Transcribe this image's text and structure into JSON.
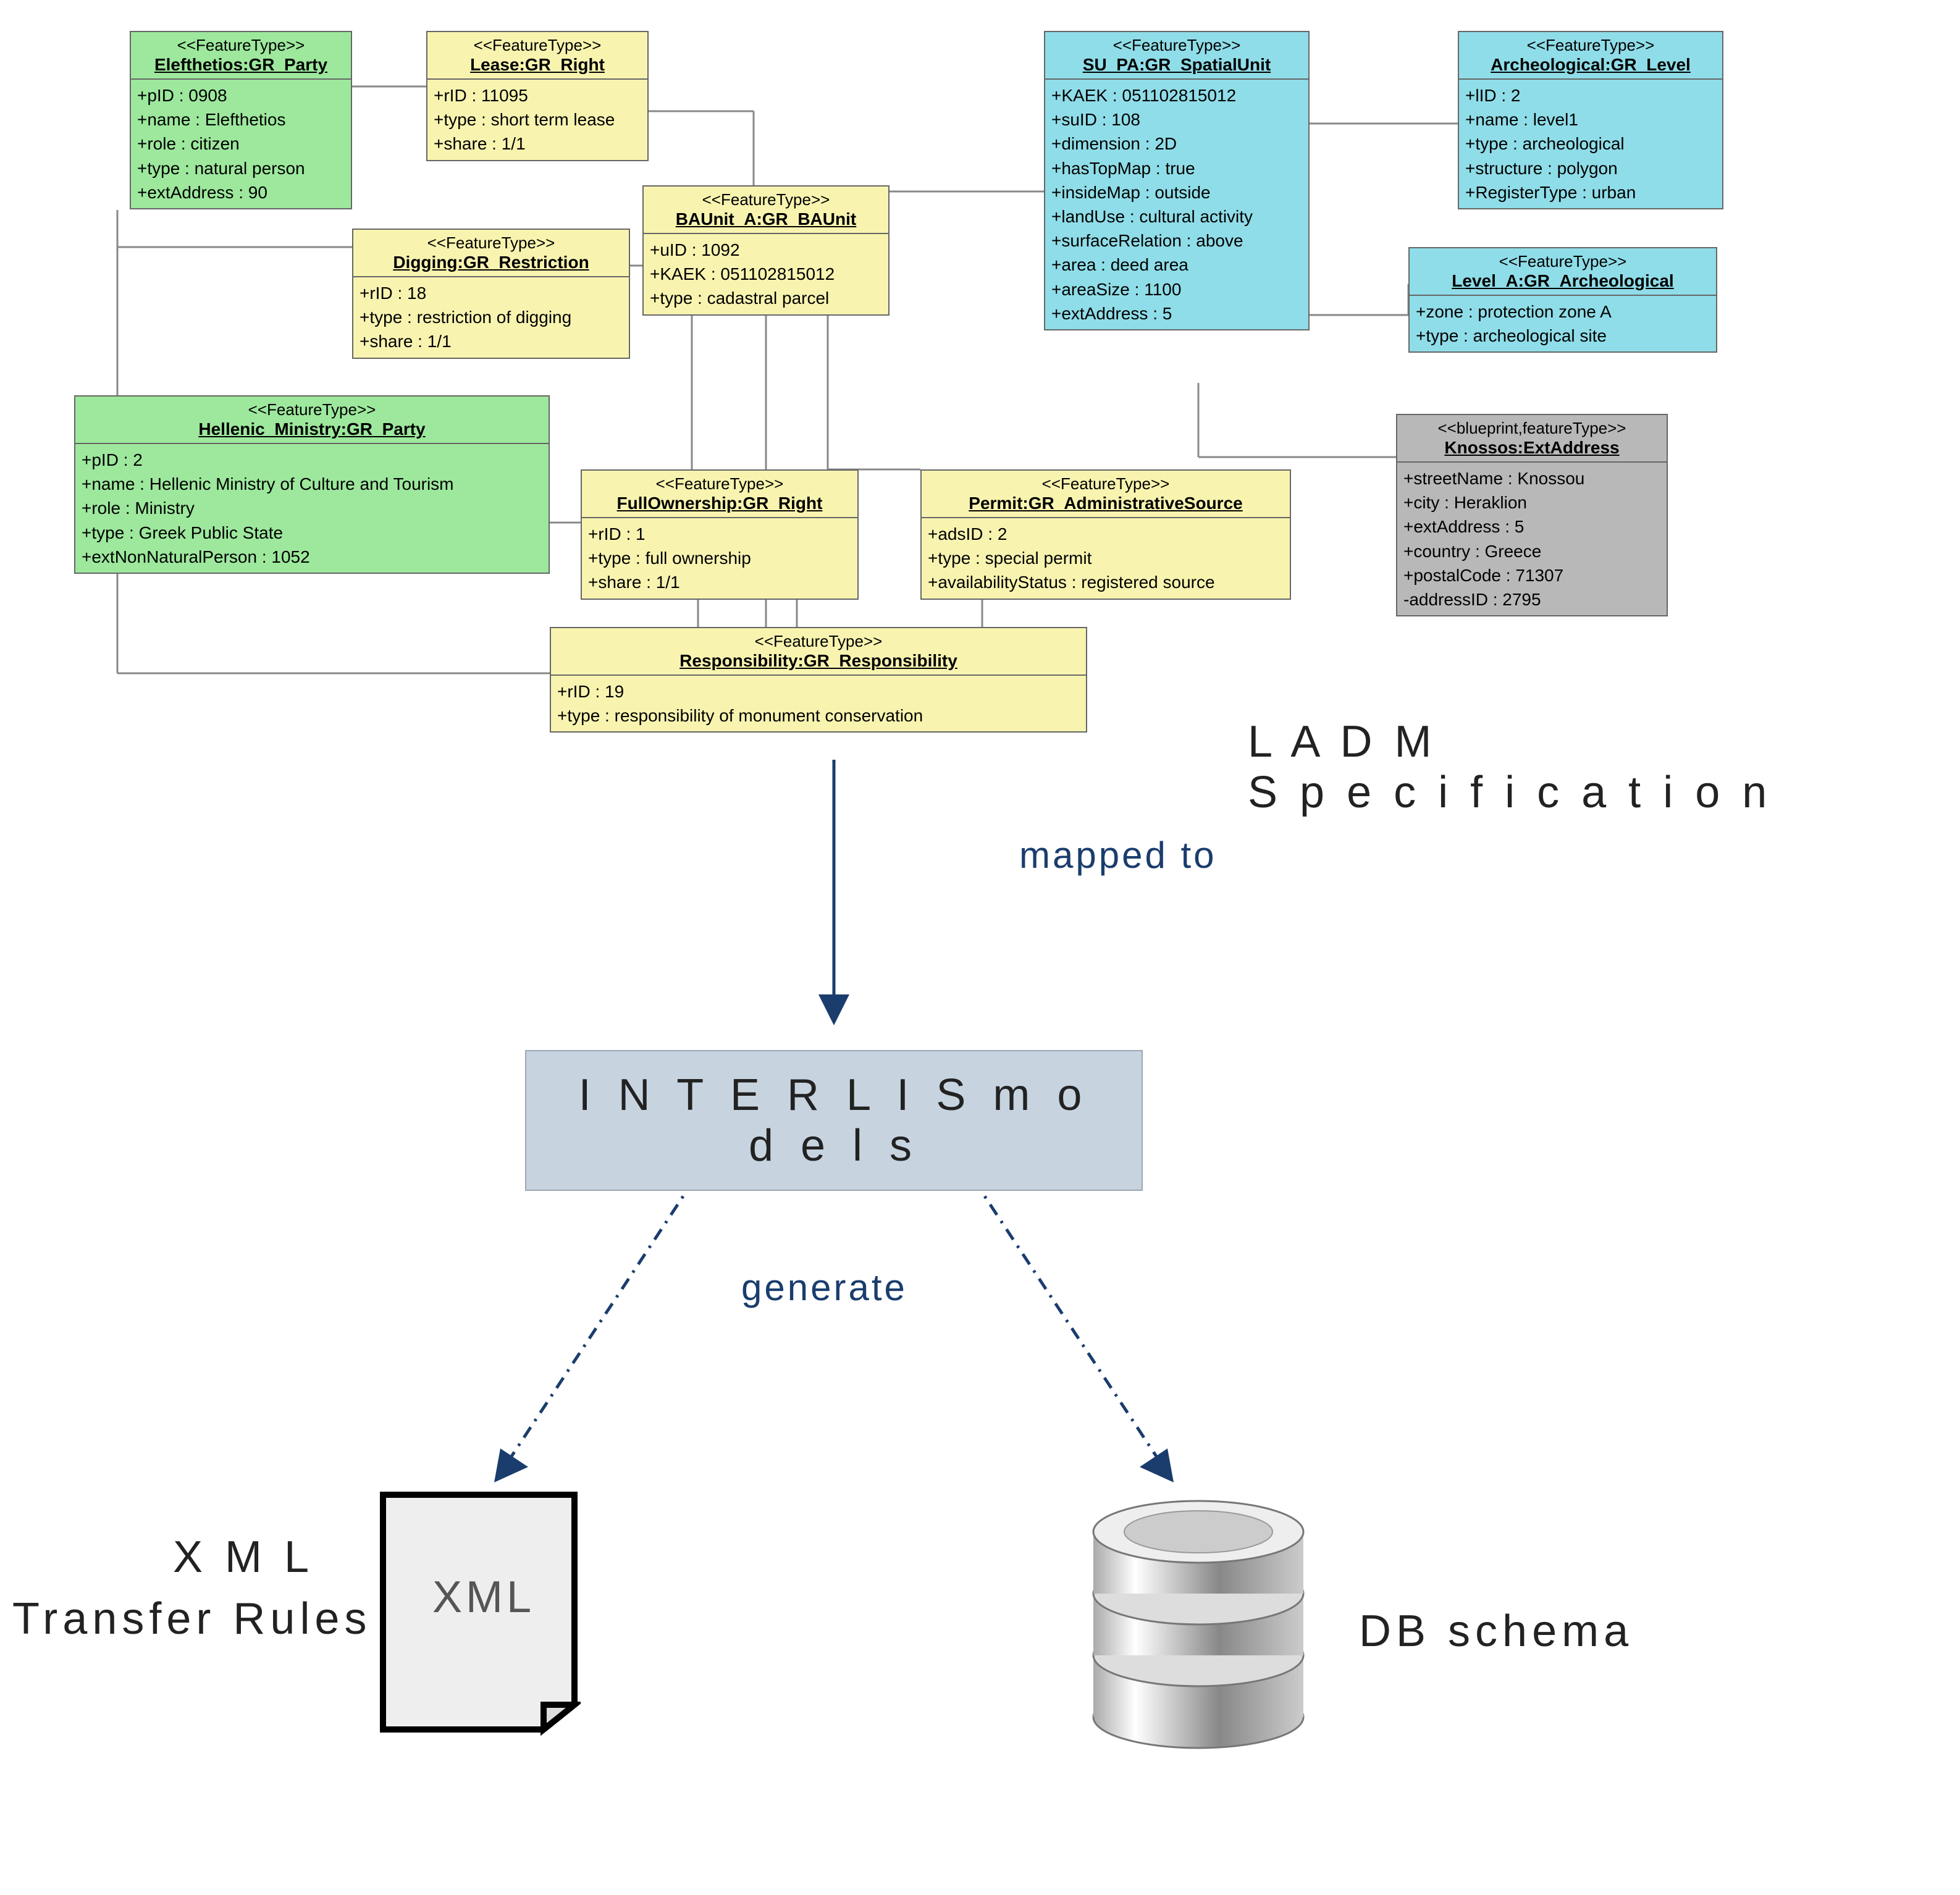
{
  "boxes": {
    "elefthetios": {
      "stereo": "<<FeatureType>>",
      "title": "Elefthetios:GR_Party",
      "attrs": [
        "+pID : 0908",
        "+name : Elefthetios",
        "+role : citizen",
        "+type : natural person",
        "+extAddress : 90"
      ]
    },
    "lease": {
      "stereo": "<<FeatureType>>",
      "title": "Lease:GR_Right",
      "attrs": [
        "+rID : 11095",
        "+type : short term lease",
        "+share : 1/1"
      ]
    },
    "baunit": {
      "stereo": "<<FeatureType>>",
      "title": "BAUnit_A:GR_BAUnit",
      "attrs": [
        "+uID : 1092",
        "+KAEK : 051102815012",
        "+type : cadastral parcel"
      ]
    },
    "digging": {
      "stereo": "<<FeatureType>>",
      "title": "Digging:GR_Restriction",
      "attrs": [
        "+rID : 18",
        "+type : restriction of digging",
        "+share : 1/1"
      ]
    },
    "hellenic": {
      "stereo": "<<FeatureType>>",
      "title": "Hellenic_Ministry:GR_Party",
      "attrs": [
        "+pID : 2",
        "+name : Hellenic Ministry of Culture and Tourism",
        "+role : Ministry",
        "+type : Greek Public State",
        "+extNonNaturalPerson : 1052"
      ]
    },
    "fullown": {
      "stereo": "<<FeatureType>>",
      "title": "FullOwnership:GR_Right",
      "attrs": [
        "+rID : 1",
        "+type : full ownership",
        "+share : 1/1"
      ]
    },
    "permit": {
      "stereo": "<<FeatureType>>",
      "title": "Permit:GR_AdministrativeSource",
      "attrs": [
        "+adsID : 2",
        "+type : special permit",
        "+availabilityStatus : registered source"
      ]
    },
    "responsibility": {
      "stereo": "<<FeatureType>>",
      "title": "Responsibility:GR_Responsibility",
      "attrs": [
        "+rID : 19",
        "+type : responsibility of monument conservation"
      ]
    },
    "supa": {
      "stereo": "<<FeatureType>>",
      "title": "SU_PA:GR_SpatialUnit",
      "attrs": [
        "+KAEK : 051102815012",
        "+suID : 108",
        "+dimension : 2D",
        "+hasTopMap : true",
        "+insideMap : outside",
        "+landUse : cultural activity",
        "+surfaceRelation : above",
        "+area : deed area",
        "+areaSize : 1100",
        "+extAddress : 5"
      ]
    },
    "archeo": {
      "stereo": "<<FeatureType>>",
      "title": "Archeological:GR_Level",
      "attrs": [
        "+lID : 2",
        "+name : level1",
        "+type : archeological",
        "+structure : polygon",
        "+RegisterType : urban"
      ]
    },
    "levela": {
      "stereo": "<<FeatureType>>",
      "title": "Level_A:GR_Archeological",
      "attrs": [
        "+zone : protection zone A",
        "+type : archeological site"
      ]
    },
    "knossos": {
      "stereo": "<<blueprint,featureType>>",
      "title": "Knossos:ExtAddress",
      "attrs": [
        "+streetName : Knossou",
        "+city : Heraklion",
        "+extAddress : 5",
        "+country : Greece",
        "+postalCode : 71307",
        "-addressID : 2795"
      ]
    }
  },
  "labels": {
    "ladm1": "L A D M",
    "ladm2": "S p e c i f i c a t i o n",
    "mapped": "mapped to",
    "interlis": "I N T E R L I S   m o d e l s",
    "generate": "generate",
    "xml": "X M L",
    "xmlRules": "Transfer Rules",
    "xmlBadge": "XML",
    "db": "DB  schema"
  }
}
